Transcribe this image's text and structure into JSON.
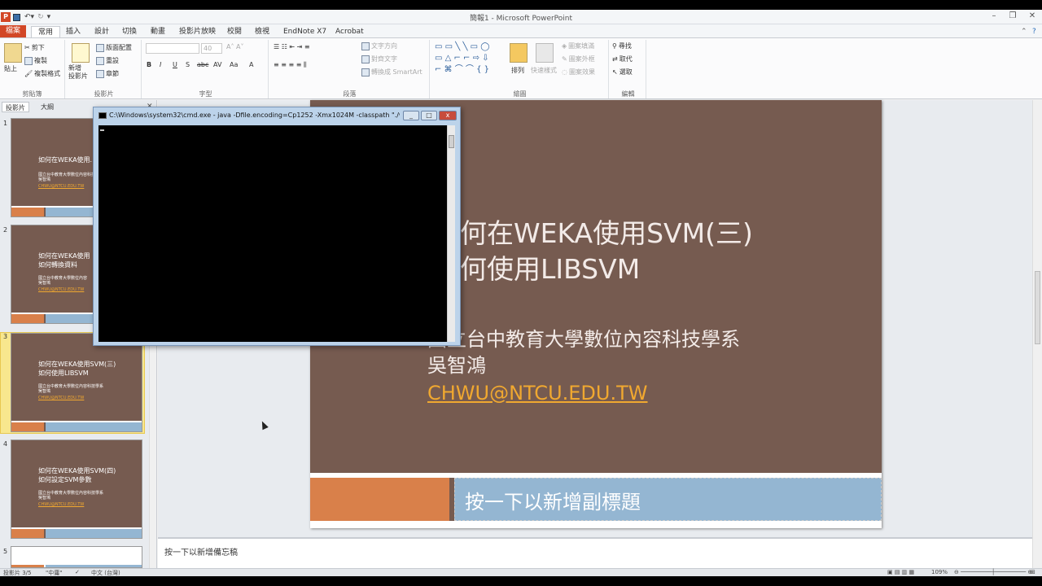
{
  "window": {
    "title": "簡報1 - Microsoft PowerPoint"
  },
  "qat": {
    "app_icon": "P"
  },
  "tabs": [
    "常用",
    "插入",
    "設計",
    "切換",
    "動畫",
    "投影片放映",
    "校閱",
    "檢視",
    "EndNote X7",
    "Acrobat"
  ],
  "file_tab": "檔案",
  "ribbon": {
    "clipboard": {
      "label": "剪貼簿",
      "paste": "貼上",
      "cut": "剪下",
      "copy": "複製",
      "format_painter": "複製格式"
    },
    "slides": {
      "label": "投影片",
      "new_slide": "新增\n投影片",
      "layout": "版面配置",
      "reset": "重設",
      "section": "章節"
    },
    "font": {
      "label": "字型",
      "size": "40"
    },
    "paragraph": {
      "label": "段落",
      "text_direction": "文字方向",
      "align_text": "對齊文字",
      "smartart": "轉換成 SmartArt"
    },
    "drawing": {
      "label": "繪圖",
      "arrange": "排列",
      "quick_styles": "快速樣式",
      "shape_fill": "圖案填滿",
      "shape_outline": "圖案外框",
      "shape_effects": "圖案效果"
    },
    "editing": {
      "label": "編輯",
      "find": "尋找",
      "replace": "取代",
      "select": "選取"
    }
  },
  "left_pane": {
    "tabs": [
      "投影片",
      "大綱"
    ],
    "thumbnails": [
      {
        "num": "1",
        "title": "如何在WEKA使用...",
        "sub": "國立台中教育大學數位內容科技學系\n吳智鴻",
        "email": "CHWU@NTCU.EDU.TW"
      },
      {
        "num": "2",
        "title": "如何在WEKA使用\n如何轉換資料",
        "sub": "國立台中教育大學數位內容\n吳智鴻",
        "email": "CHWU@NTCU.EDU.TW"
      },
      {
        "num": "3",
        "title": "如何在WEKA使用SVM(三)\n如何使用LIBSVM",
        "sub": "國立台中教育大學數位內容科技學系\n吳智鴻",
        "email": "CHWU@NTCU.EDU.TW"
      },
      {
        "num": "4",
        "title": "如何在WEKA使用SVM(四)\n如何設定SVM參數",
        "sub": "國立台中教育大學數位內容科技學系\n吳智鴻",
        "email": "CHWU@NTCU.EDU.TW"
      },
      {
        "num": "5"
      }
    ]
  },
  "slide": {
    "title": "何在WEKA使用SVM(三)\n何使用LIBSVM",
    "subtitle_lines": "國立台中教育大學數位內容科技學系\n吳智鴻",
    "email": "CHWU@NTCU.EDU.TW",
    "subtitle_placeholder": "按一下以新增副標題"
  },
  "notes": {
    "placeholder": "按一下以新增備忘稿"
  },
  "status": {
    "slide_of": "投影片 3/5",
    "theme": "\"中庸\"",
    "language": "中文 (台灣)",
    "zoom": "109%"
  },
  "cmd": {
    "title": "C:\\Windows\\system32\\cmd.exe - java  -Dfile.encoding=Cp1252 -Xmx1024M -classpath \"./we...",
    "minimize": "_",
    "maximize": "□",
    "close": "x"
  }
}
